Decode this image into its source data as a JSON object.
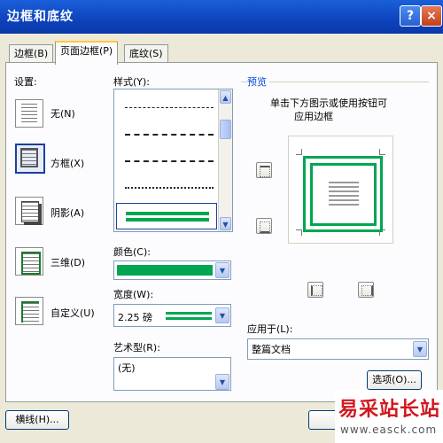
{
  "window": {
    "title": "边框和底纹",
    "help_label": "?",
    "close_label": "×"
  },
  "tabs": [
    {
      "label": "边框(B)"
    },
    {
      "label": "页面边框(P)"
    },
    {
      "label": "底纹(S)"
    }
  ],
  "settings": {
    "label": "设置:",
    "items": [
      {
        "label": "无(N)"
      },
      {
        "label": "方框(X)"
      },
      {
        "label": "阴影(A)"
      },
      {
        "label": "三维(D)"
      },
      {
        "label": "自定义(U)"
      }
    ]
  },
  "style": {
    "label": "样式(Y):"
  },
  "color": {
    "label": "颜色(C):",
    "value": "#00a651"
  },
  "width": {
    "label": "宽度(W):",
    "value": "2.25 磅"
  },
  "art": {
    "label": "艺术型(R):",
    "value": "(无)"
  },
  "preview": {
    "label": "预览",
    "hint_line1": "单击下方图示或使用按钮可",
    "hint_line2": "应用边框"
  },
  "apply_to": {
    "label": "应用于(L):",
    "value": "整篇文档"
  },
  "buttons": {
    "options": "选项(O)...",
    "horizontal_line": "横线(H)..."
  },
  "watermark": {
    "brand": "易采站长站",
    "url": "www.easck.com"
  },
  "icons": {
    "up": "▲",
    "down": "▼"
  }
}
